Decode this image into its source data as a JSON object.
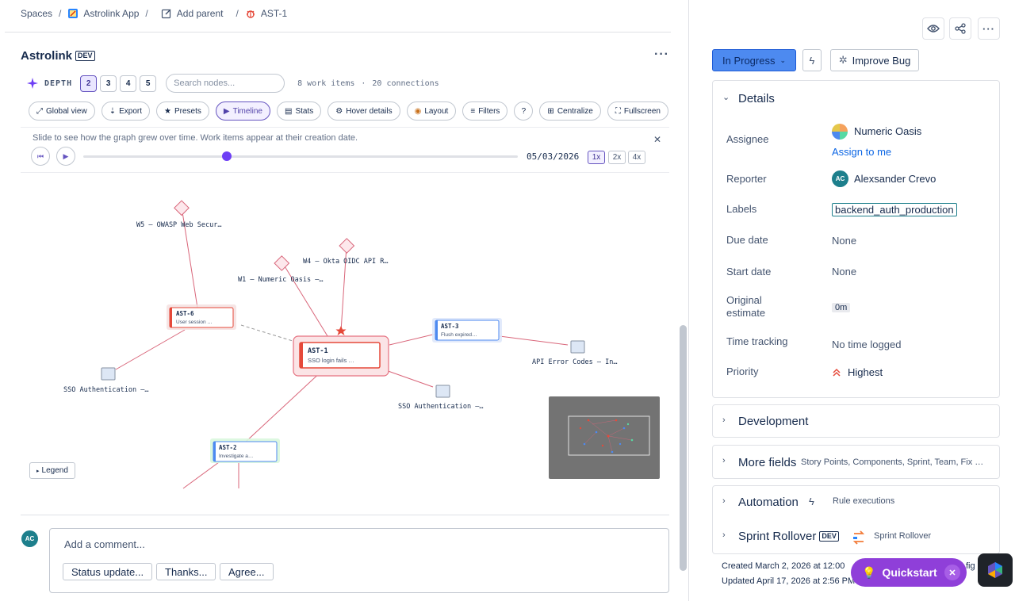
{
  "breadcrumb": {
    "spaces": "Spaces",
    "app": "Astrolink App",
    "add_parent": "Add parent",
    "issue": "AST-1"
  },
  "header": {
    "title": "Astrolink",
    "env_badge": "DEV"
  },
  "graph_controls": {
    "depth_label": "DEPTH",
    "depths": [
      "2",
      "3",
      "4",
      "5"
    ],
    "active_depth": "2",
    "search_placeholder": "Search nodes...",
    "work_items": "8 work items",
    "connections": "20 connections",
    "separator": "·"
  },
  "toolbar": {
    "global_view": "Global view",
    "export": "Export",
    "presets": "Presets",
    "timeline": "Timeline",
    "stats": "Stats",
    "hover_details": "Hover details",
    "layout": "Layout",
    "filters": "Filters",
    "help": "?",
    "centralize": "Centralize",
    "fullscreen": "Fullscreen"
  },
  "timeline": {
    "hint": "Slide to see how the graph grew over time. Work items appear at their creation date.",
    "date": "05/03/2026",
    "position": 0.33,
    "speeds": [
      "1x",
      "2x",
      "4x"
    ],
    "active_speed": "1x"
  },
  "graph": {
    "nodes": {
      "w5": "W5 – OWASP Web Secur…",
      "w4": "W4 – Okta OIDC API R…",
      "w1": "W1 – Numeric Oasis –…",
      "ast6_id": "AST-6",
      "ast6_sub": "User session …",
      "ast1_id": "AST-1",
      "ast1_sub": "SSO login fails …",
      "ast3_id": "AST-3",
      "ast3_sub": "Flush expired…",
      "ast2_id": "AST-2",
      "ast2_sub": "Investigate a…",
      "api_codes": "API Error Codes – In…",
      "sso_auth_left": "SSO Authentication –…",
      "sso_auth_right": "SSO Authentication –…"
    },
    "legend": "Legend"
  },
  "comment": {
    "avatar": "AC",
    "placeholder": "Add a comment...",
    "quick_replies": [
      "Status update...",
      "Thanks...",
      "Agree..."
    ]
  },
  "sidebar": {
    "status": "In Progress",
    "improve": "Improve Bug",
    "details": {
      "heading": "Details",
      "assignee_label": "Assignee",
      "assignee": "Numeric Oasis",
      "assign_to_me": "Assign to me",
      "reporter_label": "Reporter",
      "reporter_avatar": "AC",
      "reporter": "Alexsander Crevo",
      "labels_label": "Labels",
      "label_value": "backend_auth_production",
      "due_label": "Due date",
      "due": "None",
      "start_label": "Start date",
      "start": "None",
      "estimate_label_1": "Original",
      "estimate_label_2": "estimate",
      "estimate": "0m",
      "tracking_label": "Time tracking",
      "tracking": "No time logged",
      "priority_label": "Priority",
      "priority": "Highest"
    },
    "development": "Development",
    "more_fields": "More fields",
    "more_fields_hint": "Story Points, Components, Sprint, Team, Fix …",
    "automation": "Automation",
    "rule_executions": "Rule executions",
    "sprint_rollover": "Sprint Rollover",
    "sprint_rollover_badge": "DEV",
    "sprint_rollover_app": "Sprint Rollover",
    "created": "Created March 2, 2026 at 12:00",
    "created_tail": "figu",
    "updated": "Updated April 17, 2026 at 2:56 PM",
    "quickstart": "Quickstart"
  },
  "colors": {
    "accent": "#6e3ff5",
    "status_blue": "#4d8af0",
    "edge": "#d9667a",
    "quickstart": "#8f3fd9"
  }
}
